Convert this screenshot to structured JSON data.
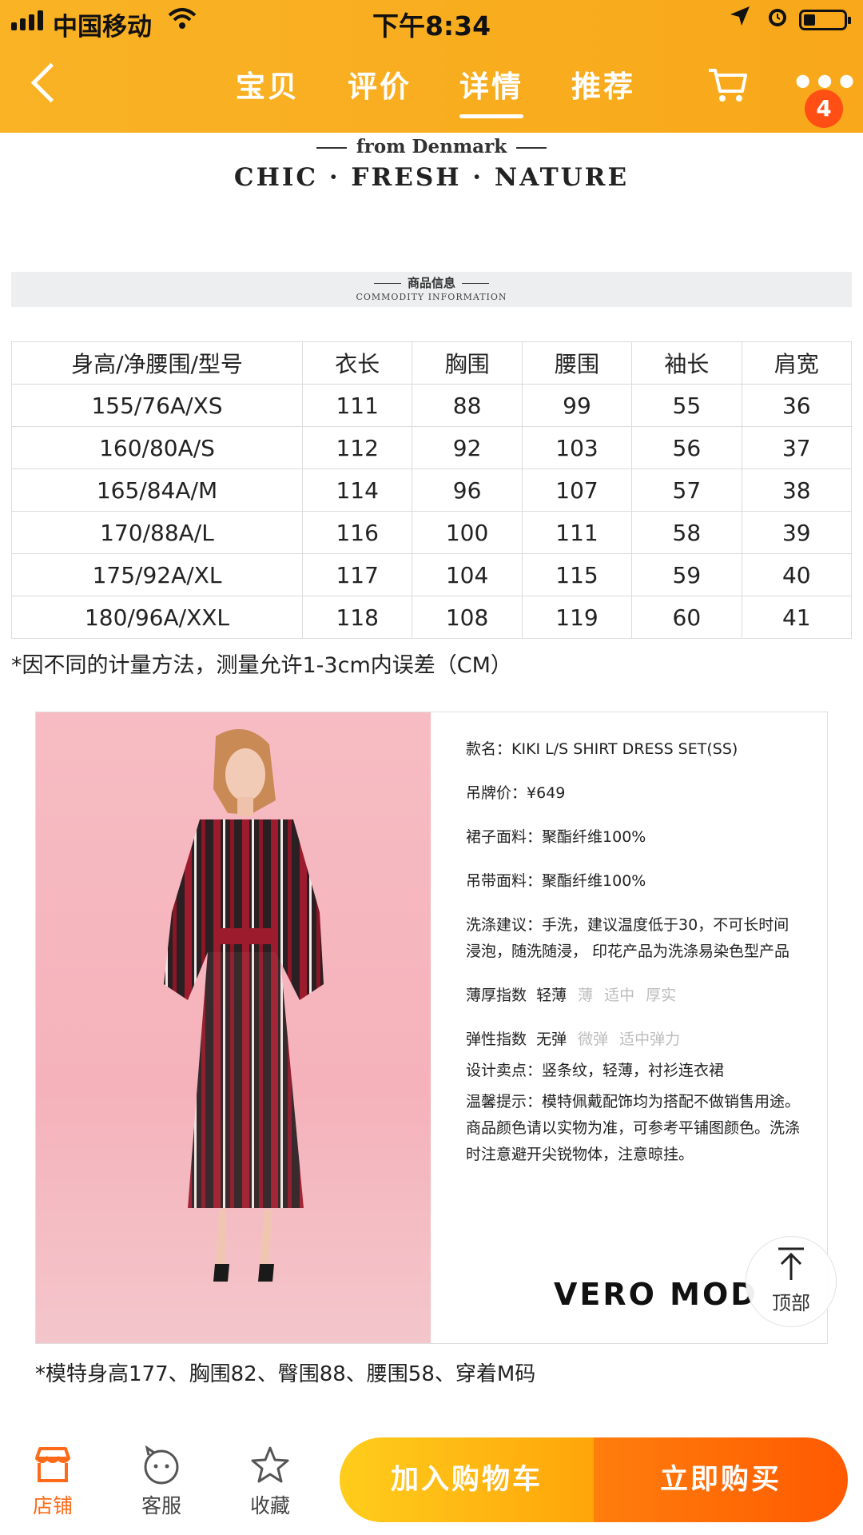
{
  "status": {
    "carrier": "中国移动",
    "time": "下午8:34"
  },
  "nav": {
    "tabs": [
      "宝贝",
      "评价",
      "详情",
      "推荐"
    ],
    "active_tab": "详情",
    "cart_badge": "4"
  },
  "brand": {
    "from": "from Denmark",
    "slogan": "CHIC · FRESH · NATURE"
  },
  "info_header": {
    "title": "商品信息",
    "subtitle": "COMMODITY INFORMATION"
  },
  "size_table": {
    "headers": [
      "身高/净腰围/型号",
      "衣长",
      "胸围",
      "腰围",
      "袖长",
      "肩宽"
    ],
    "rows": [
      [
        "155/76A/XS",
        "111",
        "88",
        "99",
        "55",
        "36"
      ],
      [
        "160/80A/S",
        "112",
        "92",
        "103",
        "56",
        "37"
      ],
      [
        "165/84A/M",
        "114",
        "96",
        "107",
        "57",
        "38"
      ],
      [
        "170/88A/L",
        "116",
        "100",
        "111",
        "58",
        "39"
      ],
      [
        "175/92A/XL",
        "117",
        "104",
        "115",
        "59",
        "40"
      ],
      [
        "180/96A/XXL",
        "118",
        "108",
        "119",
        "60",
        "41"
      ]
    ]
  },
  "measure_note": "*因不同的计量方法，测量允许1-3cm内误差（CM）",
  "product": {
    "style_label": "款名：",
    "style": "KIKI L/S SHIRT DRESS SET(SS)",
    "price_label": "吊牌价：",
    "price": "¥649",
    "skirt_label": "裙子面料：",
    "skirt": "聚酯纤维100%",
    "strap_label": "吊带面料：",
    "strap": "聚酯纤维100%",
    "wash_label": "洗涤建议：",
    "wash": "手洗，建议温度低于30，不可长时间浸泡，随洗随浸， 印花产品为洗涤易染色型产品",
    "thickness_label": "薄厚指数",
    "thickness_options": [
      "轻薄",
      "薄",
      "适中",
      "厚实"
    ],
    "thickness_selected": "轻薄",
    "elastic_label": "弹性指数",
    "elastic_options": [
      "无弹",
      "微弹",
      "适中弹力"
    ],
    "elastic_selected": "无弹",
    "design_label": "设计卖点：",
    "design": "竖条纹，轻薄，衬衫连衣裙",
    "tip_label": "温馨提示：",
    "tip": "模特佩戴配饰均为搭配不做销售用途。商品颜色请以实物为准，可参考平铺图颜色。洗涤时注意避开尖锐物体，注意晾挂。",
    "brand_logo": "VERO MOD"
  },
  "to_top": "顶部",
  "model_note": "*模特身高177、胸围82、臀围88、腰围58、穿着M码",
  "bottom_bar": {
    "shop": "店铺",
    "service": "客服",
    "favorite": "收藏",
    "add_cart": "加入购物车",
    "buy_now": "立即购买"
  },
  "colors": {
    "header": "#f9b325",
    "accent": "#ff5a00",
    "shop_icon": "#ff6a1a"
  }
}
